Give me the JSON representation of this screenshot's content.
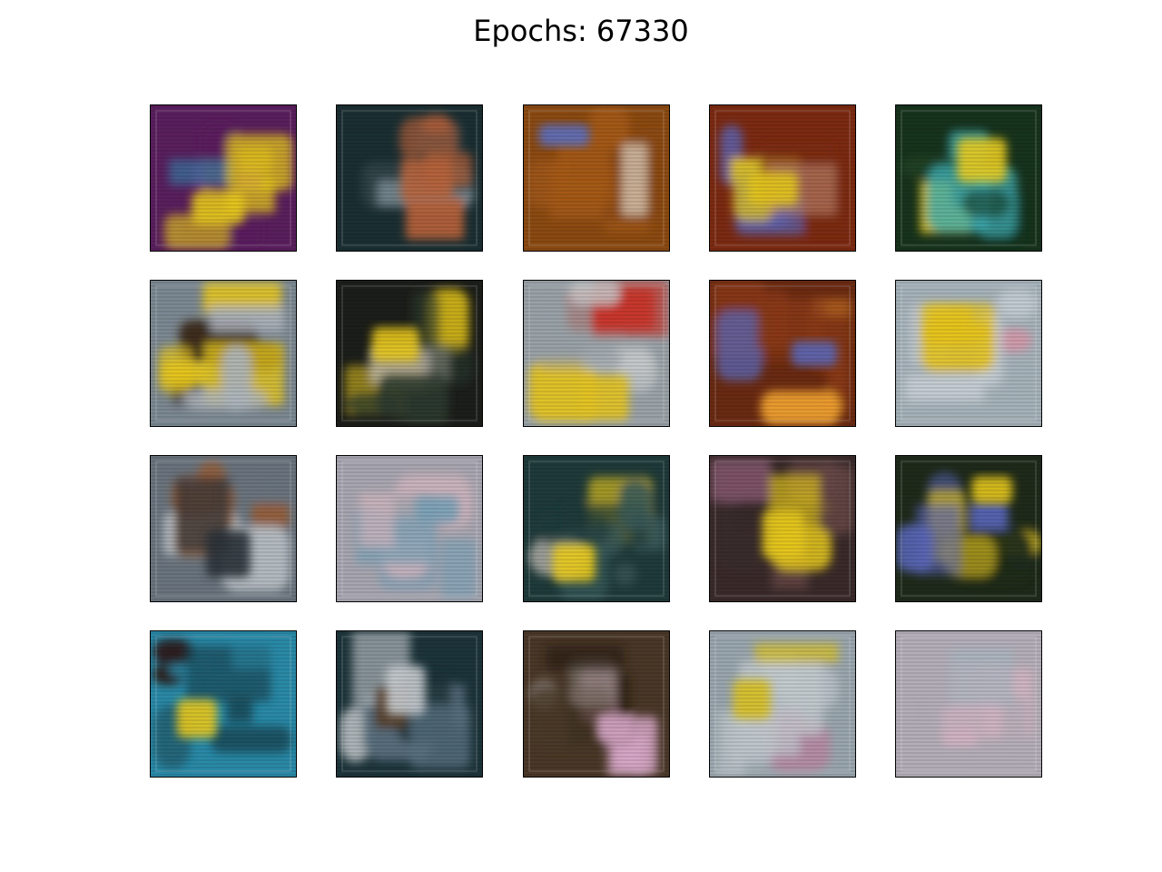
{
  "figure": {
    "title": "Epochs: 67330"
  },
  "grid": {
    "rows": 4,
    "cols": 5,
    "tiles": [
      {
        "name": "sample-r1-c1",
        "base": "#5a1f5e",
        "accent": "#8e2fa0",
        "highlight": "#e7c91a",
        "detail": "#2e8db0"
      },
      {
        "name": "sample-r1-c2",
        "base": "#1b2f33",
        "accent": "#33474a",
        "highlight": "#b8633a",
        "detail": "#7f8f98"
      },
      {
        "name": "sample-r1-c3",
        "base": "#8b4a12",
        "accent": "#a55a18",
        "highlight": "#5d6fc0",
        "detail": "#e6e0d8"
      },
      {
        "name": "sample-r1-c4",
        "base": "#7c2a12",
        "accent": "#5a66b8",
        "highlight": "#e4c61c",
        "detail": "#c08a70"
      },
      {
        "name": "sample-r1-c5",
        "base": "#17331d",
        "accent": "#244a2a",
        "highlight": "#e9cd20",
        "detail": "#40b0b8"
      },
      {
        "name": "sample-r2-c1",
        "base": "#7c8892",
        "accent": "#aeb5bd",
        "highlight": "#e8c81c",
        "detail": "#3a2818"
      },
      {
        "name": "sample-r2-c2",
        "base": "#1c1e1a",
        "accent": "#2c3a2e",
        "highlight": "#e8c81c",
        "detail": "#c8c2b8"
      },
      {
        "name": "sample-r2-c3",
        "base": "#9aa2a8",
        "accent": "#c8ccce",
        "highlight": "#e5c420",
        "detail": "#c8352a"
      },
      {
        "name": "sample-r2-c4",
        "base": "#6a2a12",
        "accent": "#8a3a18",
        "highlight": "#5c68b8",
        "detail": "#f0a030"
      },
      {
        "name": "sample-r2-c5",
        "base": "#a6b2ba",
        "accent": "#c8d0d6",
        "highlight": "#e6c41c",
        "detail": "#d498a8"
      },
      {
        "name": "sample-r3-c1",
        "base": "#6a747e",
        "accent": "#c2c8cc",
        "highlight": "#2a3038",
        "detail": "#a05a2a"
      },
      {
        "name": "sample-r3-c2",
        "base": "#a8a6b0",
        "accent": "#c6bac6",
        "highlight": "#7aa2b8",
        "detail": "#d8b8c0"
      },
      {
        "name": "sample-r3-c3",
        "base": "#1f3a3a",
        "accent": "#3a5a5a",
        "highlight": "#e9ca1c",
        "detail": "#c8c2b8"
      },
      {
        "name": "sample-r3-c4",
        "base": "#3a2a2a",
        "accent": "#6a4a48",
        "highlight": "#e6c81c",
        "detail": "#a06a88"
      },
      {
        "name": "sample-r3-c5",
        "base": "#1f2a1a",
        "accent": "#5a66b8",
        "highlight": "#e6c81c",
        "detail": "#40a0a0"
      },
      {
        "name": "sample-r4-c1",
        "base": "#2a8aa8",
        "accent": "#1a4a58",
        "highlight": "#e8c81c",
        "detail": "#2a1a14"
      },
      {
        "name": "sample-r4-c2",
        "base": "#1c343a",
        "accent": "#5a7080",
        "highlight": "#c8ccd0",
        "detail": "#5a4028"
      },
      {
        "name": "sample-r4-c3",
        "base": "#4a3828",
        "accent": "#8a8078",
        "highlight": "#d8a8c8",
        "detail": "#2a1e14"
      },
      {
        "name": "sample-r4-c4",
        "base": "#9aa6ae",
        "accent": "#c4ccd0",
        "highlight": "#d8c020",
        "detail": "#c080a0"
      },
      {
        "name": "sample-r4-c5",
        "base": "#b4aeb8",
        "accent": "#c8c0c8",
        "highlight": "#d4b4c4",
        "detail": "#a8b8c0"
      }
    ]
  }
}
